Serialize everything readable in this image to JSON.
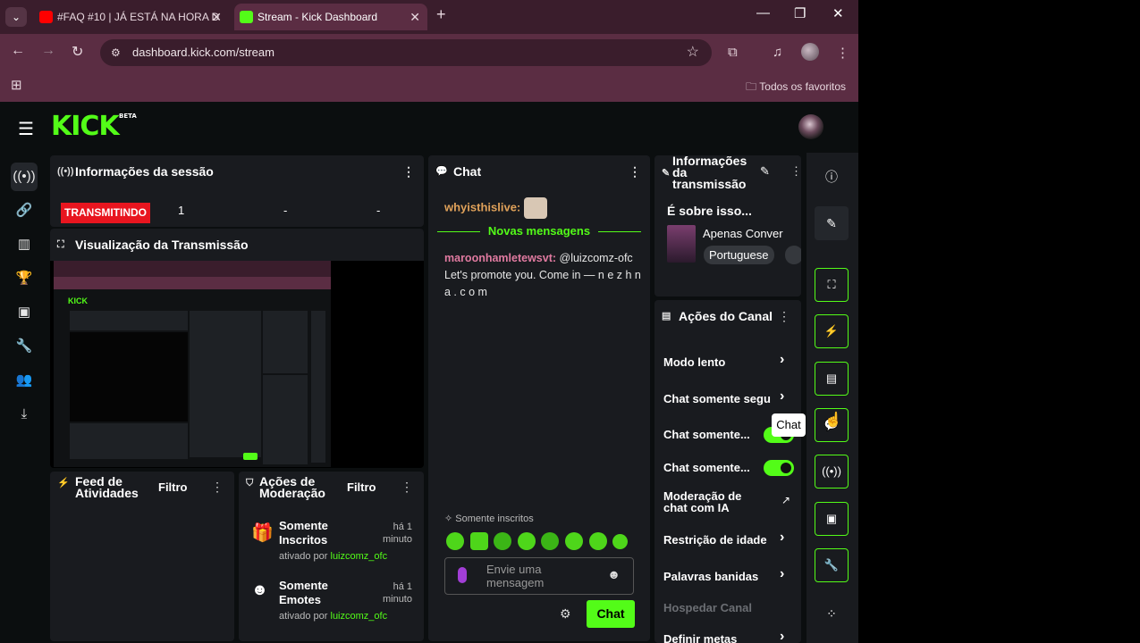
{
  "browser": {
    "tabs": [
      {
        "title": "#FAQ #10 | JÁ ESTÁ NA HORA D",
        "favicon": "youtube-icon"
      },
      {
        "title": "Stream - Kick Dashboard",
        "favicon": "kick-icon"
      }
    ],
    "url": "dashboard.kick.com/stream",
    "bookmarks_folder": "Todos os favoritos"
  },
  "header": {
    "logo": "KICK",
    "logo_badge": "BETA"
  },
  "session": {
    "title": "Informações da sessão",
    "status_badge": "TRANSMITINDO",
    "stats": [
      "1",
      "-",
      "-"
    ]
  },
  "preview": {
    "title": "Visualização da Transmissão"
  },
  "feed": {
    "title": "Feed de Atividades",
    "filter": "Filtro"
  },
  "moderation": {
    "title": "Ações de Moderação",
    "filter": "Filtro",
    "items": [
      {
        "title": "Somente Inscritos",
        "time": "há 1 minuto",
        "by_prefix": "ativado por",
        "by_user": "luizcomz_ofc"
      },
      {
        "title": "Somente Emotes",
        "time": "há 1 minuto",
        "by_prefix": "ativado por",
        "by_user": "luizcomz_ofc"
      }
    ]
  },
  "chat": {
    "title": "Chat",
    "first_user": "whyisthislive:",
    "new_messages": "Novas mensagens",
    "message_user": "maroonhamletewsvt:",
    "message_text": "@luizcomz-ofc Let's promote you. Come in — n e z h n a . c o m",
    "subscribers_only": "Somente inscritos",
    "input_placeholder": "Envie uma mensagem",
    "send_label": "Chat"
  },
  "stream_info": {
    "title": "Informações da transmissão",
    "about": "É sobre isso...",
    "category": "Apenas Conver",
    "language": "Portuguese"
  },
  "channel_actions": {
    "title": "Ações do Canal",
    "items": [
      {
        "label": "Modo lento",
        "control": "arrow"
      },
      {
        "label": "Chat somente segu",
        "control": "arrow"
      },
      {
        "label": "Chat somente...",
        "control": "toggle"
      },
      {
        "label": "Chat somente...",
        "control": "toggle"
      },
      {
        "label": "Moderação de chat com IA",
        "control": "external"
      },
      {
        "label": "Restrição de idade",
        "control": "arrow"
      },
      {
        "label": "Palavras banidas",
        "control": "arrow"
      },
      {
        "label": "Hospedar Canal",
        "control": "none"
      },
      {
        "label": "Definir metas",
        "control": "arrow"
      }
    ]
  },
  "tooltip": "Chat",
  "colors": {
    "accent": "#53fc18",
    "live": "#e8151f",
    "browser_frame": "#5b2d43"
  }
}
